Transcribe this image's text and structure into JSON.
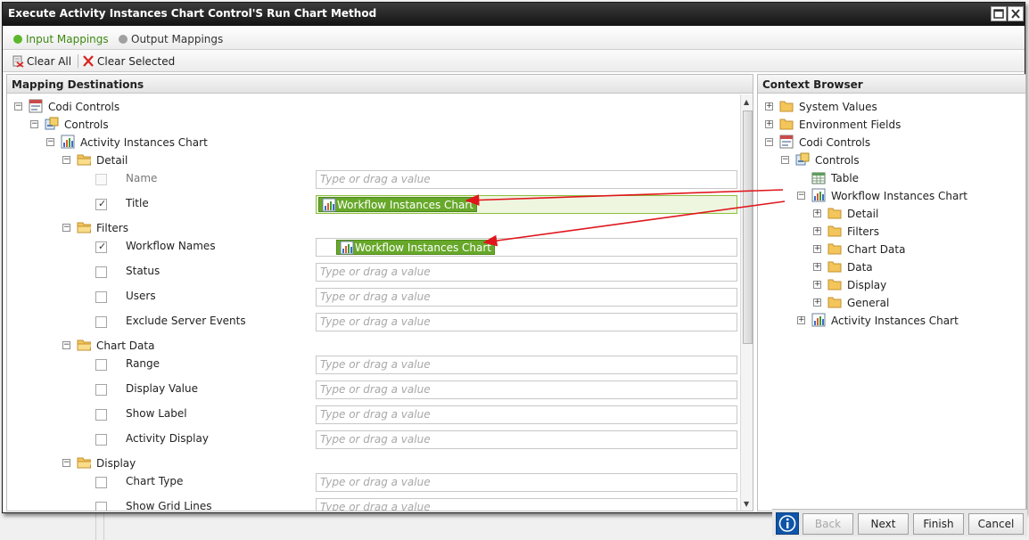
{
  "dialog": {
    "title": "Execute Activity Instances Chart Control'S Run Chart Method"
  },
  "mapping_tabs": {
    "input": "Input Mappings",
    "output": "Output Mappings"
  },
  "toolbar": {
    "clear_all": "Clear All",
    "clear_selected": "Clear Selected"
  },
  "left_panel": {
    "header": "Mapping Destinations",
    "placeholder": "Type or drag a value",
    "tree": {
      "root": "Codi Controls",
      "controls": "Controls",
      "chart": "Activity Instances Chart",
      "groups": {
        "detail": "Detail",
        "filters": "Filters",
        "chart_data": "Chart Data",
        "display": "Display"
      },
      "fields": {
        "name": "Name",
        "title": "Title",
        "workflow_names": "Workflow Names",
        "status": "Status",
        "users": "Users",
        "exclude_server_events": "Exclude Server Events",
        "range": "Range",
        "display_value": "Display Value",
        "show_label": "Show Label",
        "activity_display": "Activity Display",
        "chart_type": "Chart Type",
        "show_grid_lines": "Show Grid Lines"
      },
      "mapped_values": {
        "title": "Workflow Instances Chart",
        "workflow_names": "Workflow Instances Chart"
      }
    }
  },
  "right_panel": {
    "header": "Context Browser",
    "tree": {
      "system_values": "System Values",
      "environment_fields": "Environment Fields",
      "codi_controls": "Codi Controls",
      "controls": "Controls",
      "table": "Table",
      "workflow_chart": "Workflow Instances Chart",
      "children": [
        "Detail",
        "Filters",
        "Chart Data",
        "Data",
        "Display",
        "General"
      ],
      "activity_chart": "Activity Instances Chart"
    }
  },
  "footer": {
    "back": "Back",
    "next": "Next",
    "finish": "Finish",
    "cancel": "Cancel"
  },
  "colors": {
    "chip_green": "#67a82a",
    "arrow_red": "#e0161b",
    "title_bar": "#1e1e1e",
    "info_blue": "#0e55a8"
  }
}
